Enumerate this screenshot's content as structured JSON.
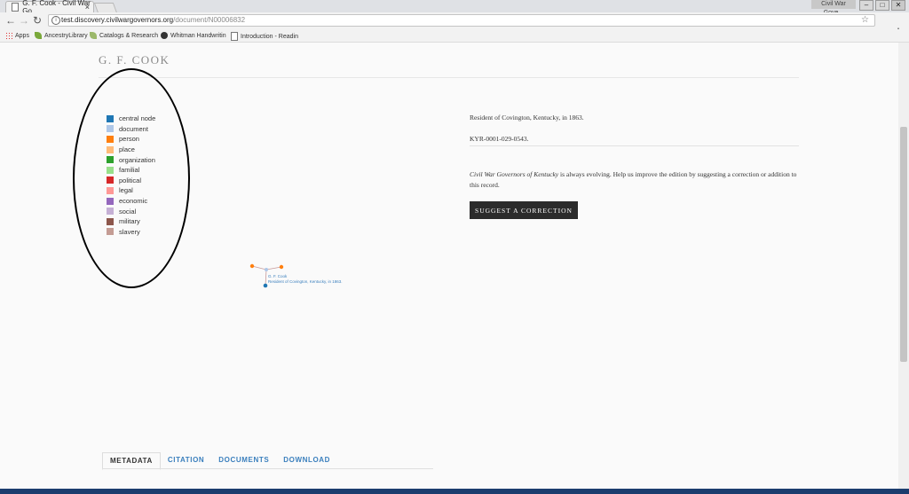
{
  "browser": {
    "tab_title": "G. F. Cook - Civil War Go",
    "tab_close": "×",
    "profile": "Civil War Gove...",
    "win_minimize": "–",
    "win_maximize": "□",
    "win_close": "✕",
    "url_host": "test.discovery.civilwargovernors.org",
    "url_path": "/document/N00006832",
    "back": "←",
    "forward": "→",
    "reload": "↻",
    "star": "☆",
    "menu": "⋮"
  },
  "bookmarks": [
    {
      "label": "Apps",
      "icon": "apps-grid-icon"
    },
    {
      "label": "AncestryLibrary",
      "icon": "leaf-icon"
    },
    {
      "label": "Catalogs & Research",
      "icon": "leaf-icon"
    },
    {
      "label": "Whitman Handwritin",
      "icon": "whitman-icon"
    },
    {
      "label": "Introduction - Readin",
      "icon": "page-icon"
    }
  ],
  "page": {
    "title": "G. F. COOK",
    "description": "Resident of Covington, Kentucky, in 1863.",
    "identifier": "KYR-0001-029-0543.",
    "evolving_title": "Civil War Governors of Kentucky",
    "evolving_text": " is always evolving. Help us improve the edition by suggesting a correction or addition to this record.",
    "suggest_button": "SUGGEST A CORRECTION"
  },
  "legend": [
    {
      "label": "central node",
      "color": "#1f77b4"
    },
    {
      "label": "document",
      "color": "#aec7e8"
    },
    {
      "label": "person",
      "color": "#ff7f0e"
    },
    {
      "label": "place",
      "color": "#ffbb78"
    },
    {
      "label": "organization",
      "color": "#2ca02c"
    },
    {
      "label": "familial",
      "color": "#98df8a"
    },
    {
      "label": "political",
      "color": "#d62728"
    },
    {
      "label": "legal",
      "color": "#ff9896"
    },
    {
      "label": "economic",
      "color": "#9467bd"
    },
    {
      "label": "social",
      "color": "#c5b0d5"
    },
    {
      "label": "military",
      "color": "#8c564b"
    },
    {
      "label": "slavery",
      "color": "#c49c94"
    }
  ],
  "graph": {
    "name": "G. F. Cook",
    "subtitle": "Resident of Covington, Kentucky, in 1863."
  },
  "tabs": [
    "METADATA",
    "CITATION",
    "DOCUMENTS",
    "DOWNLOAD"
  ],
  "active_tab": "METADATA"
}
